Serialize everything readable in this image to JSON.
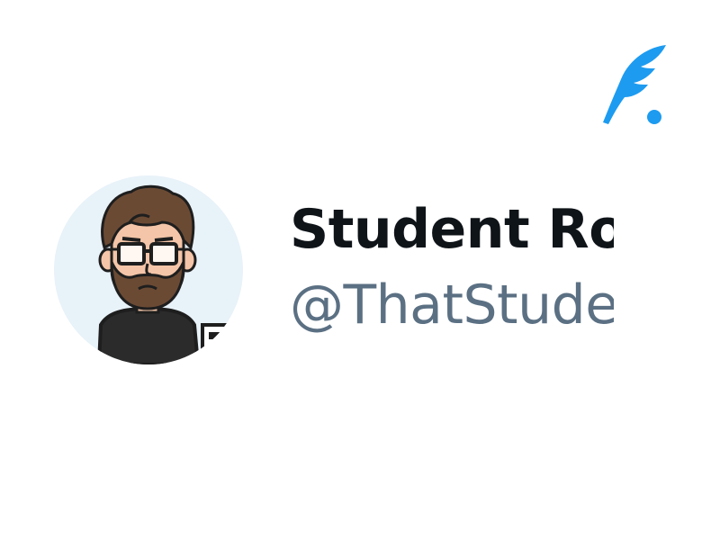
{
  "app": {
    "logo_icon": "feather-quill-icon",
    "accent_color": "#1d9bf0"
  },
  "profile": {
    "display_name": "Student Rol",
    "handle": "@ThatStude",
    "avatar_icon": "bearded-man-glasses-avatar",
    "name_color": "#0f1419",
    "handle_color": "#5b7083",
    "avatar_background": "#e8f2f9"
  }
}
